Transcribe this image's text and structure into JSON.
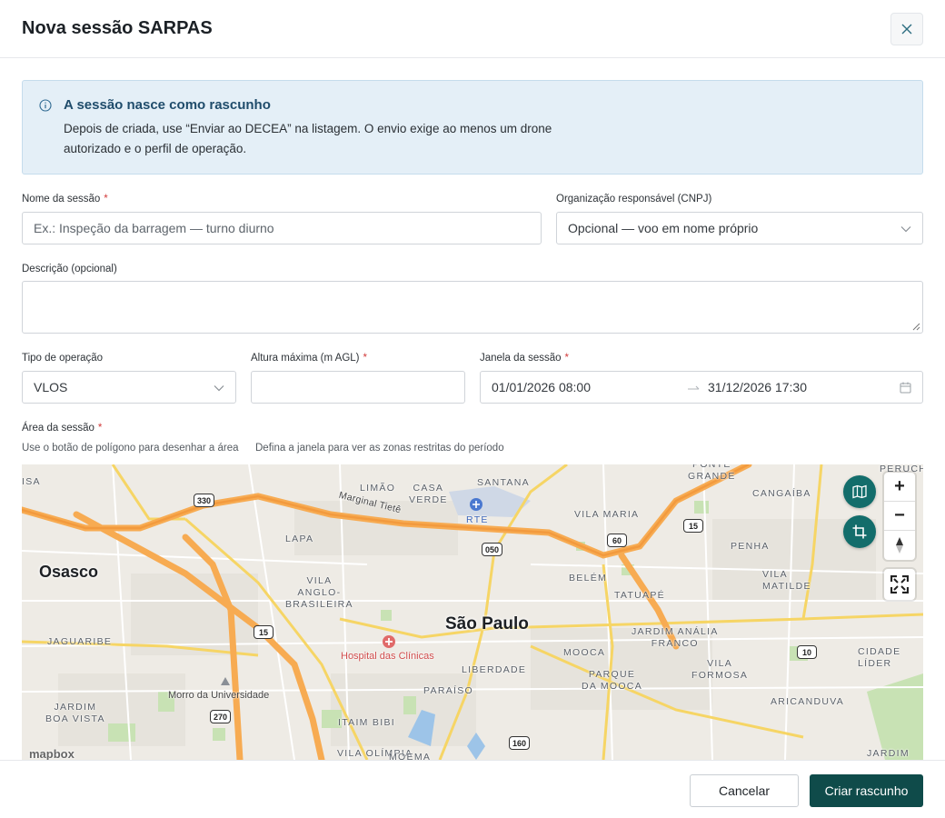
{
  "modal": {
    "title": "Nova sessão SARPAS"
  },
  "alert": {
    "title": "A sessão nasce como rascunho",
    "body": "Depois de criada, use “Enviar ao DECEA” na listagem. O envio exige ao menos um drone autorizado e o perfil de operação."
  },
  "form": {
    "name": {
      "label": "Nome da sessão",
      "required": "*",
      "placeholder": "Ex.: Inspeção da barragem — turno diurno"
    },
    "org": {
      "label": "Organização responsável (CNPJ)",
      "value": "Opcional — voo em nome próprio"
    },
    "description": {
      "label": "Descrição (opcional)"
    },
    "op_type": {
      "label": "Tipo de operação",
      "value": "VLOS"
    },
    "altitude": {
      "label": "Altura máxima (m AGL)",
      "required": "*"
    },
    "window": {
      "label": "Janela da sessão",
      "required": "*",
      "start": "01/01/2026 08:00",
      "end": "31/12/2026 17:30"
    },
    "area": {
      "label": "Área da sessão",
      "required": "*",
      "hint_polygon": "Use o botão de polígono para desenhar a área",
      "hint_window": "Defina a janela para ver as zonas restritas do período"
    }
  },
  "map": {
    "labels": {
      "osasco": "Osasco",
      "sao_paulo": "São Paulo",
      "hospital": "Hospital das Clínicas",
      "morro": "Morro da Universidade",
      "marginal": "Marginal Tietê",
      "rte": "RTE",
      "isa": "ISA",
      "limao": "LIMÃO",
      "casa_verde": "CASA\nVERDE",
      "santana": "SANTANA",
      "parque_peruche": "PARQUE\nPERUCHE",
      "ponte_grande": "PONTE\nGRANDE",
      "vila_maria": "VILA MARIA",
      "cangaiba": "CANGAÍBA",
      "lapa": "LAPA",
      "penha": "PENHA",
      "belem": "BELÉM",
      "vila_matilde": "VILA\nMATILDE",
      "tatuape": "TATUAPÉ",
      "vila_anglo": "VILA\nANGLO-\nBRASILEIRA",
      "jaguaribe": "JAGUARIBE",
      "jardim_analia": "JARDIM ANÁLIA\nFRANCO",
      "mooca": "MOOCA",
      "vila_formosa": "VILA\nFORMOSA",
      "cidade_lider": "CIDADE\nLÍDER",
      "liberdade": "LIBERDADE",
      "parque_mooca": "PARQUE\nDA MOOCA",
      "jardim_bv": "JARDIM\nBOA VISTA",
      "paraiso": "PARAÍSO",
      "aricanduva": "ARICANDUVA",
      "itaim": "ITAIM BIBI",
      "vila_olimpia": "VILA OLÍMPIA",
      "moema": "MOEMA",
      "jardim_s": "JARDIM",
      "mapbox": "mapbox"
    },
    "shields": [
      "330",
      "15",
      "050",
      "60",
      "15",
      "10",
      "270",
      "160"
    ],
    "controls": {
      "zoom_in": "+",
      "zoom_out": "−"
    }
  },
  "footer": {
    "cancel": "Cancelar",
    "submit": "Criar rascunho"
  },
  "colors": {
    "primary": "#0f4b4a",
    "accent": "#136d6b",
    "required": "#d23b3b"
  }
}
